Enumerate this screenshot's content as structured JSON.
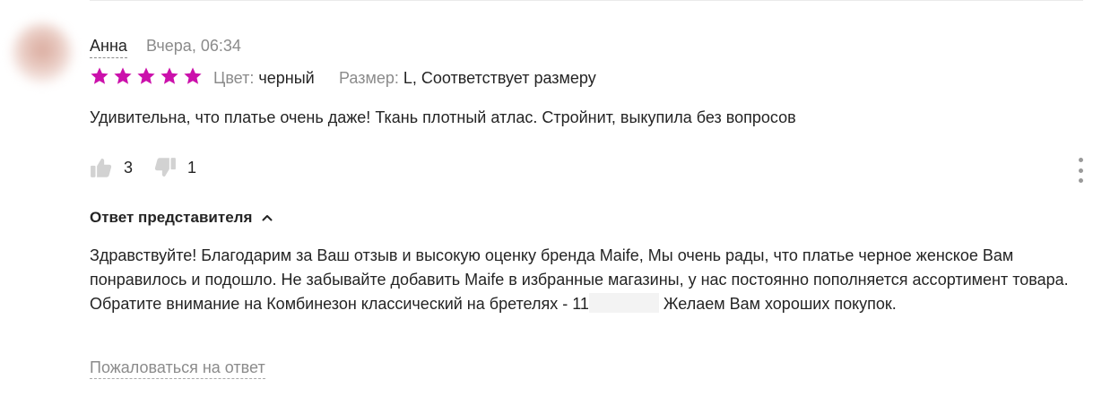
{
  "review": {
    "author": "Анна",
    "date": "Вчера, 06:34",
    "rating": 5,
    "star_color": "#cb11ab",
    "attributes": [
      {
        "label": "Цвет:",
        "value": "черный"
      },
      {
        "label": "Размер:",
        "value": "L, Соответствует размеру"
      }
    ],
    "text": "Удивительна, что платье очень даже! Ткань плотный атлас. Стройнит, выкупила без вопросов",
    "likes": "3",
    "dislikes": "1",
    "icons": {
      "like": "thumbs-up-icon",
      "dislike": "thumbs-down-icon",
      "more": "more-vertical-icon"
    }
  },
  "reply": {
    "title": "Ответ представителя",
    "text_before": "Здравствуйте! Благодарим за Ваш отзыв и высокую оценку бренда Maife, Мы очень рады, что платье черное женское Вам понравилось и подошло. Не забывайте добавить Maife в избранные магазины, у нас постоянно пополняется ассортимент товара. Обратите внимание на Комбинезон классический на бретелях - 11",
    "text_after": "Желаем Вам хороших покупок.",
    "complain_label": "Пожаловаться на ответ"
  }
}
